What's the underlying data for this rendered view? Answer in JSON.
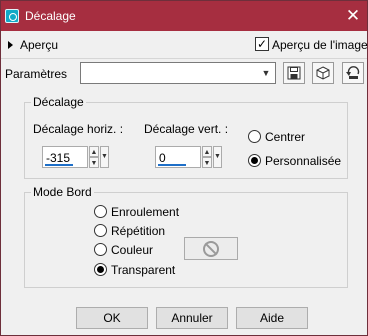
{
  "window": {
    "title": "Décalage",
    "app_icon": "paintshop-icon",
    "close_glyph": "✕"
  },
  "preview": {
    "label": "Aperçu",
    "image_preview_label": "Aperçu de l'image",
    "image_preview_checked": true
  },
  "params": {
    "label": "Paramètres",
    "preset_value": "",
    "icons": [
      "save-preset-icon",
      "cube-preset-icon",
      "reset-icon"
    ]
  },
  "offset": {
    "title": "Décalage",
    "horizontal_label": "Décalage horiz. :",
    "horizontal_value": "-315",
    "vertical_label": "Décalage vert. :",
    "vertical_value": "0",
    "options": [
      {
        "label": "Centrer",
        "selected": false
      },
      {
        "label": "Personnalisée",
        "selected": true
      }
    ]
  },
  "edge_mode": {
    "title": "Mode Bord",
    "options": [
      {
        "label": "Enroulement",
        "selected": false
      },
      {
        "label": "Répétition",
        "selected": false
      },
      {
        "label": "Couleur",
        "selected": false
      },
      {
        "label": "Transparent",
        "selected": true
      }
    ],
    "color_swatch_icon": "no-color-icon"
  },
  "buttons": {
    "ok": "OK",
    "cancel": "Annuler",
    "help": "Aide"
  },
  "colors": {
    "titlebar": "#a62e40",
    "accent": "#1e6fc8"
  }
}
